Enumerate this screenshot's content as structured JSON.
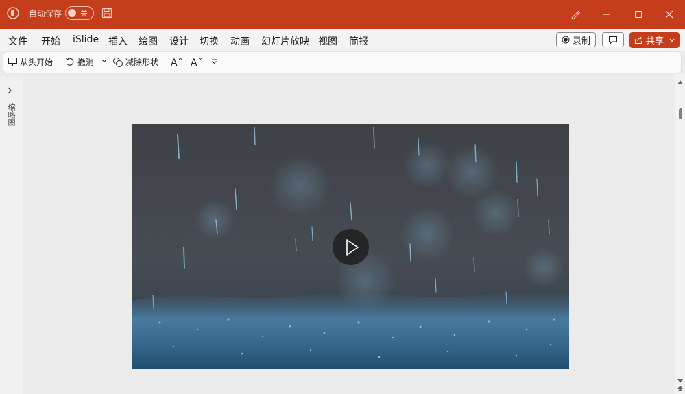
{
  "titlebar": {
    "autosave_label": "自动保存",
    "autosave_state": "关",
    "colors": {
      "accent": "#c43e1c"
    }
  },
  "menu": {
    "items": [
      "文件",
      "开始",
      "iSlide",
      "插入",
      "绘图",
      "设计",
      "切换",
      "动画",
      "幻灯片放映",
      "视图",
      "简报"
    ],
    "record_label": "录制",
    "share_label": "共享"
  },
  "quick_access": {
    "from_start_label": "从头开始",
    "undo_label": "撤消",
    "subtract_shape_label": "减除形状"
  },
  "thumbnail_pane": {
    "label": "缩略图"
  },
  "icons": [
    "powerpoint-logo-icon",
    "save-icon",
    "pen-icon",
    "minimize-icon",
    "maximize-icon",
    "close-icon",
    "record-icon",
    "comment-icon",
    "share-icon",
    "chevron-down-icon",
    "present-icon",
    "undo-icon",
    "subtract-shape-icon",
    "increase-font-icon",
    "decrease-font-icon",
    "customize-qat-icon",
    "expand-pane-icon",
    "play-icon",
    "scroll-up-icon",
    "scroll-down-icon"
  ]
}
